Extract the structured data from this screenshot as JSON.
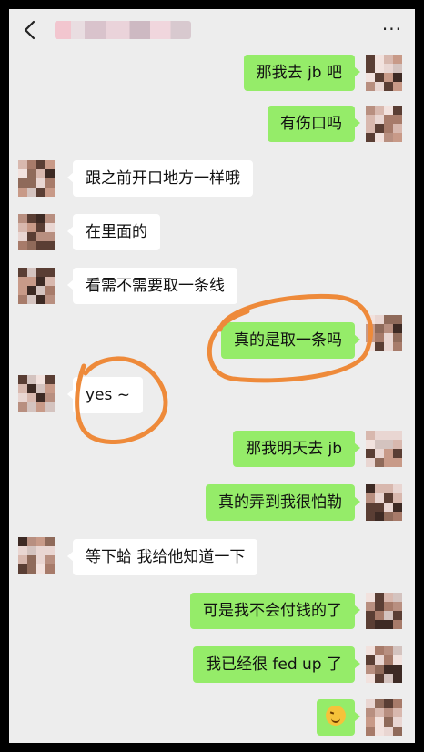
{
  "header": {
    "back_icon": "chevron-left-icon",
    "title_blurred": "",
    "more_icon": "more-dots-icon",
    "more_label": "···"
  },
  "messages": [
    {
      "side": "out",
      "text": "那我去 jb 吧"
    },
    {
      "side": "out",
      "text": "有伤口吗"
    },
    {
      "side": "in",
      "text": "跟之前开口地方一样哦"
    },
    {
      "side": "in",
      "text": "在里面的"
    },
    {
      "side": "in",
      "text": "看需不需要取一条线"
    },
    {
      "side": "out",
      "text": "真的是取一条吗"
    },
    {
      "side": "in",
      "text": "yes ~"
    },
    {
      "side": "out",
      "text": "那我明天去 jb"
    },
    {
      "side": "out",
      "text": "真的弄到我很怕勒"
    },
    {
      "side": "in",
      "text": "等下蛤 我给他知道一下"
    },
    {
      "side": "out",
      "text": "可是我不会付钱的了"
    },
    {
      "side": "out",
      "text": "我已经很 fed up 了"
    },
    {
      "side": "out",
      "text": "",
      "emoji": "grinning-squint-emoji"
    }
  ],
  "colors": {
    "outgoing_bubble": "#95ec69",
    "incoming_bubble": "#ffffff",
    "background": "#ededed",
    "annotation_circle": "#ee8a3a"
  }
}
